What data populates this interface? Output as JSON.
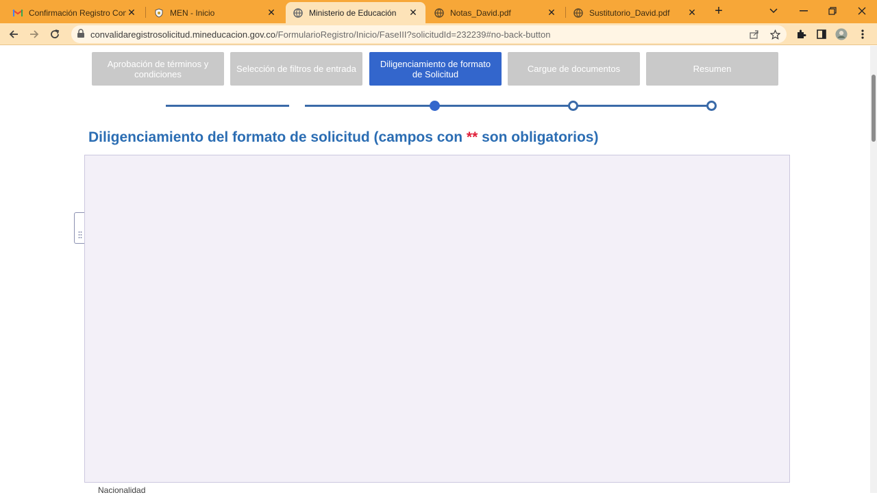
{
  "browser": {
    "tabs": [
      {
        "title": "Confirmación Registro Conv",
        "favicon": "gmail-icon",
        "active": false
      },
      {
        "title": "MEN - Inicio",
        "favicon": "shield-icon",
        "active": false
      },
      {
        "title": "Ministerio de Educación",
        "favicon": "globe-icon",
        "active": true
      },
      {
        "title": "Notas_David.pdf",
        "favicon": "globe-icon",
        "active": false
      },
      {
        "title": "Sustitutorio_David.pdf",
        "favicon": "globe-icon",
        "active": false
      }
    ],
    "url_host": "convalidaregistrosolicitud.mineducacion.gov.co",
    "url_path": "/FormularioRegistro/Inicio/FaseIII?solicitudId=232239#no-back-button",
    "accent_color": "#f7a738"
  },
  "wizard": {
    "steps": [
      {
        "label": "Aprobación de términos y condiciones",
        "active": false
      },
      {
        "label": "Selección de filtros de entrada",
        "active": false
      },
      {
        "label": "Diligenciamiento de formato de Solicitud",
        "active": true
      },
      {
        "label": "Cargue de documentos",
        "active": false
      },
      {
        "label": "Resumen",
        "active": false
      }
    ],
    "active_color": "#3366cc"
  },
  "form": {
    "heading_prefix": "Diligenciamiento del formato de solicitud (campos con ",
    "heading_required": "**",
    "heading_suffix": " son obligatorios)",
    "next_field_label": "Nacionalidad"
  }
}
